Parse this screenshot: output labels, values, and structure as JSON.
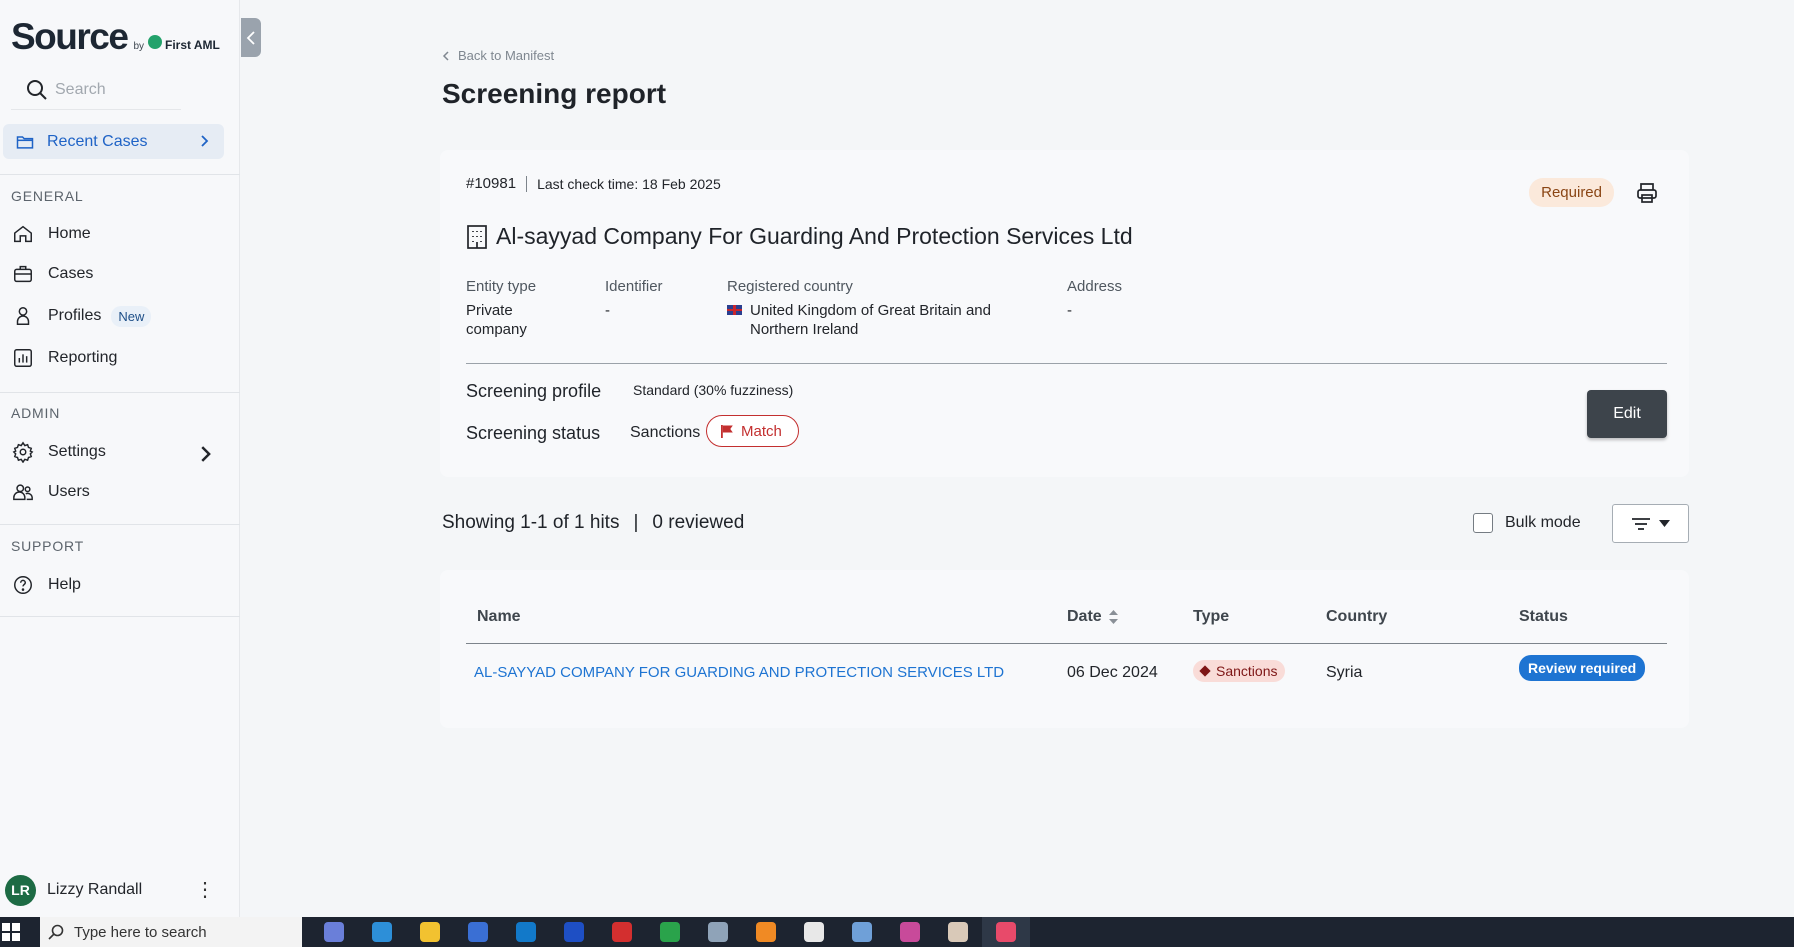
{
  "sidebar": {
    "logo": {
      "main": "Source",
      "by": "by",
      "brand": "First AML"
    },
    "search": {
      "placeholder": "Search"
    },
    "recent_cases": "Recent Cases",
    "general_title": "GENERAL",
    "general_items": [
      {
        "label": "Home",
        "icon": "home-icon"
      },
      {
        "label": "Cases",
        "icon": "briefcase-icon"
      },
      {
        "label": "Profiles",
        "icon": "person-icon",
        "badge": "New"
      },
      {
        "label": "Reporting",
        "icon": "chart-icon"
      }
    ],
    "admin_title": "ADMIN",
    "admin_items": [
      {
        "label": "Settings",
        "icon": "gear-icon"
      },
      {
        "label": "Users",
        "icon": "users-icon"
      }
    ],
    "support_title": "SUPPORT",
    "support_items": [
      {
        "label": "Help",
        "icon": "help-icon"
      }
    ],
    "user": {
      "initials": "LR",
      "name": "Lizzy Randall",
      "avatar_color": "#1d6b44"
    }
  },
  "header": {
    "back_link": "Back to Manifest",
    "title": "Screening report"
  },
  "case": {
    "id": "#10981",
    "last_check": "Last check time: 18 Feb 2025",
    "status_badge": "Required",
    "entity_name": "Al-sayyad Company For Guarding And Protection Services Ltd",
    "fields": {
      "entity_type": {
        "label": "Entity type",
        "value": "Private company"
      },
      "identifier": {
        "label": "Identifier",
        "value": "-"
      },
      "registered_country": {
        "label": "Registered country",
        "value": "United Kingdom of Great Britain and Northern Ireland"
      },
      "address": {
        "label": "Address",
        "value": "-"
      }
    },
    "screening_profile_label": "Screening profile",
    "screening_profile_value": "Standard (30% fuzziness)",
    "screening_status_label": "Screening status",
    "screening_status_type": "Sanctions",
    "screening_status_value": "Match",
    "edit_label": "Edit"
  },
  "hits": {
    "showing": "Showing 1-1 of 1 hits",
    "separator": "|",
    "reviewed": "0 reviewed",
    "bulk_mode": "Bulk mode"
  },
  "table": {
    "columns": [
      "Name",
      "Date",
      "Type",
      "Country",
      "Status"
    ],
    "rows": [
      {
        "name": "AL-SAYYAD COMPANY FOR GUARDING AND PROTECTION SERVICES LTD",
        "date": "06 Dec 2024",
        "type": "Sanctions",
        "country": "Syria",
        "status": "Review required"
      }
    ]
  },
  "taskbar": {
    "search_placeholder": "Type here to search",
    "app_colors": [
      "#6a7fd9",
      "#2d8fd8",
      "#f2c230",
      "#3a6fd4",
      "#1279c9",
      "#1e4fc4",
      "#d32f2f",
      "#2aa34b",
      "#8fa3b8",
      "#f08a24",
      "#e8e8e8",
      "#6fa0d8",
      "#c84a9a",
      "#d9c9b8",
      "#e84a6a"
    ]
  },
  "colors": {
    "accent": "#1f63c6",
    "link": "#1e74d2",
    "match": "#c32f2f",
    "required_bg": "#fbe9db"
  }
}
